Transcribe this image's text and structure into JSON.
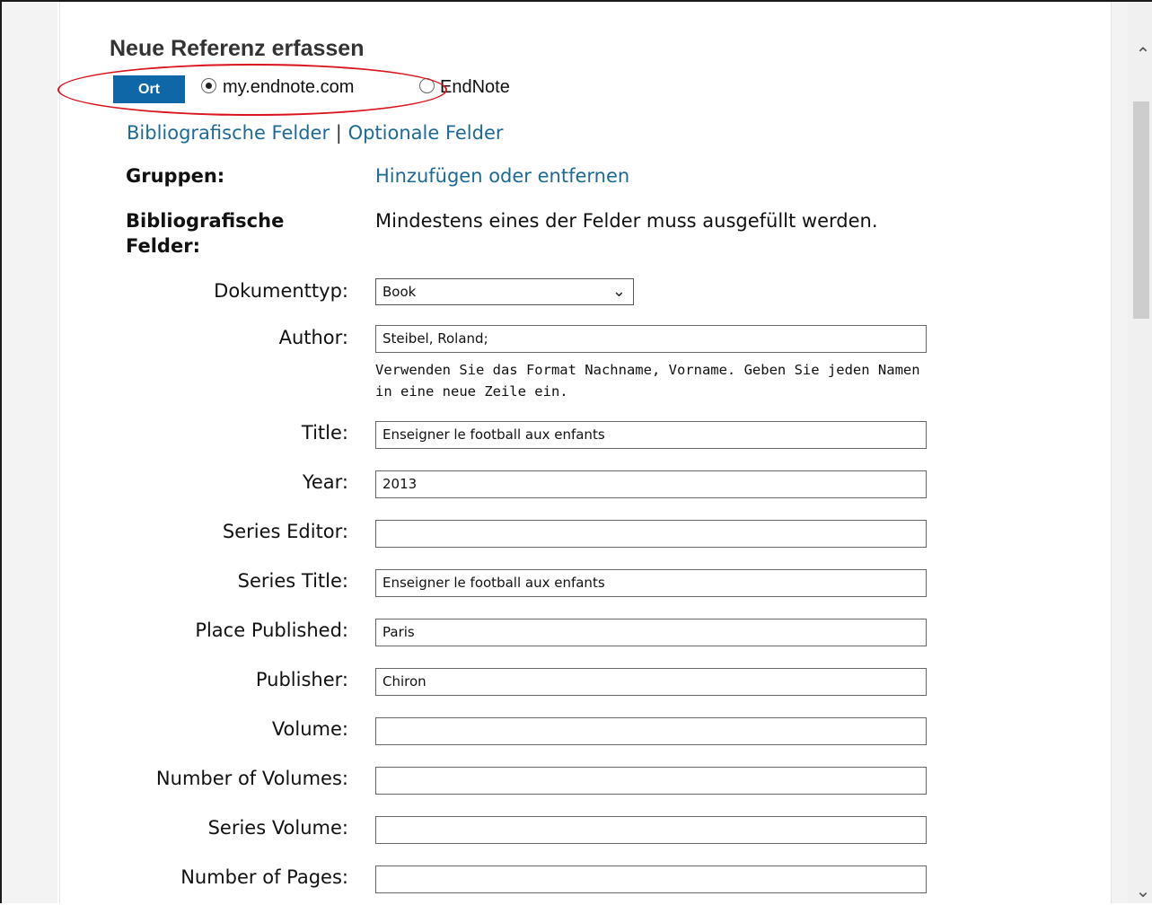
{
  "page": {
    "title": "Neue Referenz erfassen"
  },
  "location": {
    "button_label": "Ort",
    "options": [
      {
        "label": "my.endnote.com",
        "selected": true
      },
      {
        "label": "EndNote",
        "selected": false
      }
    ]
  },
  "links": {
    "bibliographic": "Bibliografische Felder",
    "separator": "|",
    "optional": "Optionale Felder"
  },
  "groups": {
    "label": "Gruppen:",
    "action": "Hinzufügen oder entfernen"
  },
  "bib_fields": {
    "label_line1": "Bibliografische",
    "label_line2": "Felder:",
    "note": "Mindestens eines der Felder muss ausgefüllt werden."
  },
  "doc_type": {
    "label": "Dokumenttyp:",
    "value": "Book"
  },
  "author": {
    "label": "Author:",
    "value": "Steibel, Roland;",
    "hint_line1": "Verwenden Sie das Format Nachname, Vorname. Geben Sie jeden Namen",
    "hint_line2": "in eine neue Zeile ein."
  },
  "fields": [
    {
      "label": "Title:",
      "value": "Enseigner le football aux enfants"
    },
    {
      "label": "Year:",
      "value": "2013"
    },
    {
      "label": "Series Editor:",
      "value": ""
    },
    {
      "label": "Series Title:",
      "value": "Enseigner le football aux enfants"
    },
    {
      "label": "Place Published:",
      "value": "Paris"
    },
    {
      "label": "Publisher:",
      "value": "Chiron"
    },
    {
      "label": "Volume:",
      "value": ""
    },
    {
      "label": "Number of Volumes:",
      "value": ""
    },
    {
      "label": "Series Volume:",
      "value": ""
    },
    {
      "label": "Number of Pages:",
      "value": ""
    }
  ],
  "icons": {
    "scroll_up": "chevron-up-icon",
    "scroll_down": "chevron-down-icon",
    "select_arrow": "chevron-down-icon"
  },
  "colors": {
    "button_bg": "#0f67a7",
    "link": "#1d6a96",
    "annotation": "#d9141c"
  }
}
